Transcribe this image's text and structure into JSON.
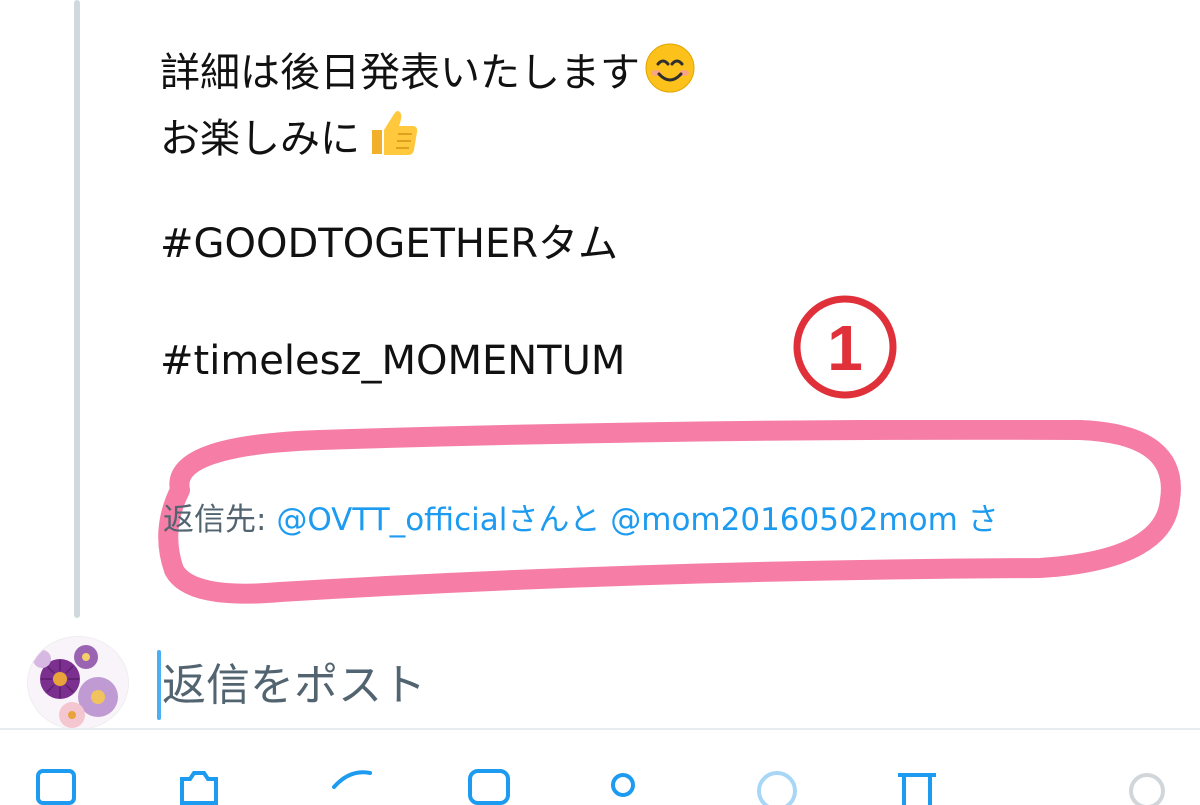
{
  "tweet": {
    "lines": [
      "詳細は後日発表いたします",
      "お楽しみに",
      "#GOODTOGETHERタム",
      "#timelesz_MOMENTUM"
    ],
    "emojis": [
      "smiling-face-emoji",
      "thumbs-up-emoji"
    ]
  },
  "annotation": {
    "number": "①",
    "color": "#e0303a",
    "highlight_color": "#f57da6"
  },
  "reply_to": {
    "prefix": "返信先: ",
    "mention1": "@OVTT_official",
    "joiner": "さんと ",
    "mention2": "@mom20160502mom",
    "tail": " さ"
  },
  "composer": {
    "placeholder": "返信をポスト"
  },
  "toolbar": {
    "icons": [
      "image-icon",
      "camera-icon",
      "gif-icon",
      "list-icon",
      "location-icon",
      "circle-icon",
      "schedule-icon",
      "more-icon"
    ]
  },
  "colors": {
    "link": "#1d9bf0",
    "muted": "#536471",
    "thread_line": "#cfd9de",
    "accent_purple": "#8a3fa3"
  }
}
